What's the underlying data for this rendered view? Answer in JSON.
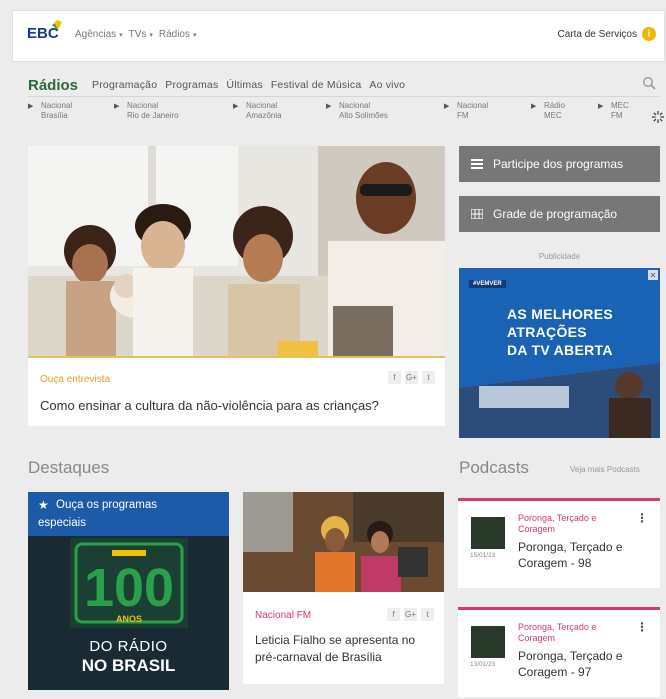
{
  "header": {
    "logo": "EBC",
    "nav": [
      {
        "label": "Agências"
      },
      {
        "label": "TVs"
      },
      {
        "label": "Rádios"
      }
    ],
    "service_link": "Carta de Serviços",
    "info_glyph": "i"
  },
  "section_nav": {
    "title": "Rádios",
    "items": [
      "Programação",
      "Programas",
      "Últimas",
      "Festival de Música",
      "Ao vivo"
    ]
  },
  "radios": [
    {
      "line1": "Nacional",
      "line2": "Brasília"
    },
    {
      "line1": "Nacional",
      "line2": "Rio de Janeiro"
    },
    {
      "line1": "Nacional",
      "line2": "Amazônia"
    },
    {
      "line1": "Nacional",
      "line2": "Alto Solimões"
    },
    {
      "line1": "Nacional",
      "line2": "FM"
    },
    {
      "line1": "Rádio",
      "line2": "MEC"
    },
    {
      "line1": "MEC",
      "line2": "FM"
    }
  ],
  "main_story": {
    "kicker": "Ouça entrevista",
    "headline": "Como ensinar a cultura da não-violência para as crianças?",
    "share": [
      "f",
      "G+",
      "t"
    ]
  },
  "side_buttons": {
    "participe": "Participe dos programas",
    "grade": "Grade de programação"
  },
  "ad": {
    "label": "Publicidade",
    "tag": "#VEMVER",
    "close": "✕",
    "line1": "AS MELHORES",
    "line2": "ATRAÇÕES",
    "line3": "DA TV ABERTA"
  },
  "destaques": {
    "title": "Destaques",
    "card1": {
      "title_line1": "Ouça os programas",
      "title_line2": "especiais",
      "big_number": "100",
      "anos": "ANOS",
      "line1": "DO RÁDIO",
      "line2": "NO BRASIL"
    },
    "card2": {
      "kicker": "Nacional FM",
      "headline": "Leticia Fialho se apresenta no pré-carnaval de Brasília",
      "share": [
        "f",
        "G+",
        "t"
      ]
    }
  },
  "podcasts": {
    "title": "Podcasts",
    "see_more": "Veja mais Podcasts",
    "items": [
      {
        "program": "Poronga, Terçado e Coragem",
        "title": "Poronga, Terçado e Coragem - 98",
        "date": "15/01/23"
      },
      {
        "program": "Poronga, Terçado e Coragem",
        "title": "Poronga, Terçado e Coragem - 97",
        "date": "13/01/23"
      }
    ]
  },
  "colors": {
    "brand_green": "#2a6a3a",
    "accent_pink": "#d63a6a",
    "accent_gold": "#e0a030",
    "button_gray": "#777777",
    "ad_blue": "#1a62b4"
  }
}
